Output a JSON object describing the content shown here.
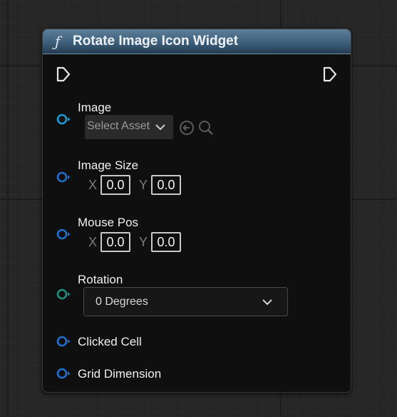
{
  "node": {
    "title": "Rotate Image Icon Widget",
    "func_icon": "ƒ",
    "header_color": "#3d5f7b"
  },
  "exec_pins": {
    "input_icon": "exec-in-icon",
    "output_icon": "exec-out-icon"
  },
  "pins": {
    "image": {
      "label": "Image",
      "asset_value": "Select Asset",
      "use_selected_icon": "arrow-left-circle-icon",
      "browse_icon": "magnifier-icon",
      "pin_color": "#1a9ad6"
    },
    "image_size": {
      "label": "Image Size",
      "x_label": "X",
      "x_value": "0.0",
      "y_label": "Y",
      "y_value": "0.0",
      "pin_color": "#1e6fd0"
    },
    "mouse_pos": {
      "label": "Mouse Pos",
      "x_label": "X",
      "x_value": "0.0",
      "y_label": "Y",
      "y_value": "0.0",
      "pin_color": "#1e6fd0"
    },
    "rotation": {
      "label": "Rotation",
      "value": "0 Degrees",
      "pin_color": "#1f8f82"
    },
    "clicked_cell": {
      "label": "Clicked Cell",
      "pin_color": "#1e6fd0"
    },
    "grid_dimension": {
      "label": "Grid Dimension",
      "pin_color": "#1e6fd0"
    }
  }
}
